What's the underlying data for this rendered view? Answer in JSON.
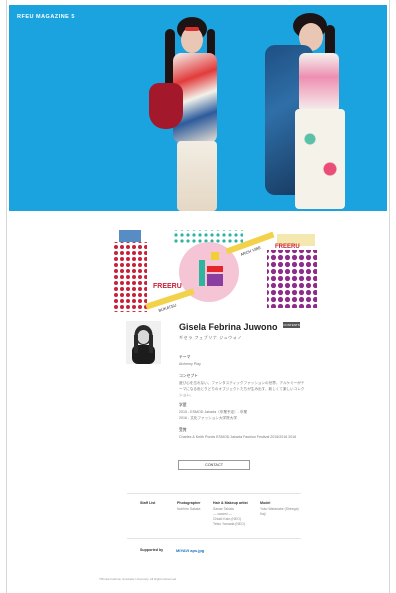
{
  "header": {
    "title": "RFEU MAGAZINE 5"
  },
  "designer": {
    "name": "Gisela Febrina Juwono",
    "kana": "ギセラ フェブリナ ジュウォノ",
    "badge": "CONTENTS"
  },
  "sections": {
    "theme_label": "テーマ",
    "theme_value": "Alchemy Play",
    "concept_label": "コンセプト",
    "concept_value": "遊び心を忘れない、ファンタスティックファッションの世界。アルケミーがテーマになる色とりどりのオブジェクトたちが生み出す、新しくて楽しいコレクション。",
    "career_label": "学歴",
    "career_lines": [
      "2015 - ESMOD Jakarta（卒業予定）- 卒業",
      "2016 - 文化ファッション大学院大学"
    ],
    "award_label": "受賞",
    "award_value": "Charles & Keith Ponds ESMOD Jakarta Fashion Festival 2015/2016 2016"
  },
  "contact_label": "CONTACT",
  "credits": {
    "staff_label": "Staff List",
    "photographer_label": "Photographer",
    "photographer_value": "Norihiro Sakata",
    "hair_label": "Hair & Makeup artist",
    "hair_lines": [
      "Sanae Takata",
      "— carami —",
      "Chiaki Kato (NEO)",
      "Tetsu Yamada (NEO)"
    ],
    "model_label": "Model",
    "model_lines": [
      "Yoko Watanabe (Sheega)",
      "Kaji"
    ]
  },
  "supported_label": "Supported by",
  "supporter_logo": "MIYAVI aps.jpg",
  "copyright": "©Bunka Fashion Graduate University. All Rights Reserved.",
  "logo_text": [
    "FREERU",
    "ARCH VIBE",
    "BUKATSU",
    "FREERU"
  ],
  "colors": {
    "hero_bg": "#1aa3df",
    "accent_red": "#c8213a",
    "accent_pink": "#ee7da6",
    "accent_teal": "#2fb4a0"
  }
}
